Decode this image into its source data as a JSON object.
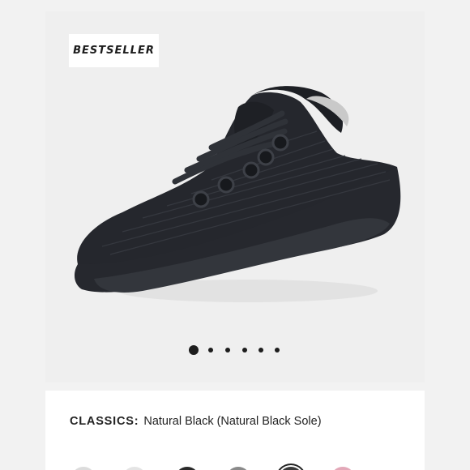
{
  "badge": {
    "text": "BESTSELLER"
  },
  "product": {
    "collection_label": "CLASSICS:",
    "colorway": "Natural Black (Natural Black Sole)",
    "image_icon": "sneaker-image"
  },
  "carousel": {
    "total": 6,
    "active": 1,
    "active_color": "#1d1d1d"
  },
  "swatches": [
    {
      "name": "light-grey-swatch",
      "color": "#dcdcdc"
    },
    {
      "name": "white-swatch",
      "color": "#e4e4e4"
    },
    {
      "name": "black-swatch",
      "color": "#2a2a2a"
    },
    {
      "name": "grey-swatch",
      "color": "#8a8a8a"
    },
    {
      "name": "dark-selected-swatch",
      "color": "#3a3a3a"
    },
    {
      "name": "pink-swatch",
      "color": "#e3a8b8"
    }
  ]
}
